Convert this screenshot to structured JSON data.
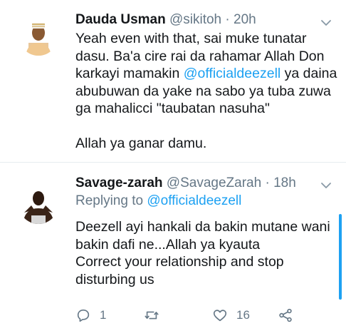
{
  "tweets": [
    {
      "display_name": "Dauda Usman",
      "handle": "@sikitoh",
      "separator": "·",
      "time": "20h",
      "body_part1": "Yeah even with that, sai muke tunatar dasu. Ba'a cire rai da rahamar Allah Don karkayi mamakin ",
      "mention": "@officialdeezell",
      "body_part2": " ya daina abubuwan da yake na sabo ya tuba zuwa ga mahalicci \"taubatan nasuha\"\n\nAllah ya ganar damu."
    },
    {
      "display_name": "Savage-zarah",
      "handle": "@SavageZarah",
      "separator": "·",
      "time": "18h",
      "replying_label": "Replying to ",
      "replying_to": "@officialdeezell",
      "body": "Deezell ayi hankali da bakin mutane wani bakin dafi ne...Allah ya kyauta\nCorrect your relationship and stop disturbing us",
      "reply_count": "1",
      "like_count": "16"
    }
  ],
  "icons": {
    "reply": "reply-icon",
    "retweet": "retweet-icon",
    "like": "heart-icon",
    "share": "share-icon",
    "menu": "chevron-down-icon"
  },
  "colors": {
    "link": "#1da1f2",
    "secondary_text": "#657786",
    "primary_text": "#14171a",
    "divider": "#e6ecf0"
  }
}
